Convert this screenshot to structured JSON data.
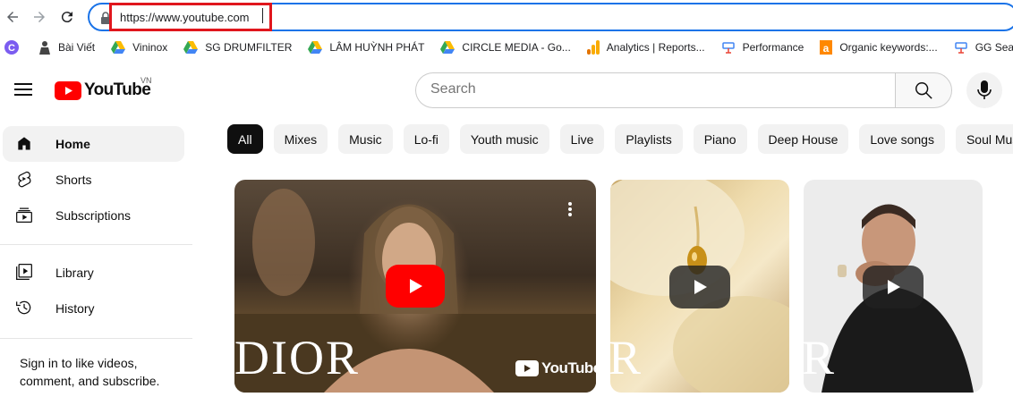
{
  "browser": {
    "url": "https://www.youtube.com"
  },
  "bookmarks": [
    {
      "label": "",
      "icon": "circle-c-icon"
    },
    {
      "label": "Bài Viết",
      "icon": "person-icon"
    },
    {
      "label": "Vininox",
      "icon": "drive-icon"
    },
    {
      "label": "SG DRUMFILTER",
      "icon": "drive-icon"
    },
    {
      "label": "LÂM HUỲNH PHÁT",
      "icon": "drive-icon"
    },
    {
      "label": "CIRCLE MEDIA - Go...",
      "icon": "drive-icon"
    },
    {
      "label": "Analytics | Reports...",
      "icon": "analytics-icon"
    },
    {
      "label": "Performance",
      "icon": "search-console-icon"
    },
    {
      "label": "Organic keywords:...",
      "icon": "ahrefs-icon"
    },
    {
      "label": "GG Search Console",
      "icon": "search-console-icon"
    }
  ],
  "masthead": {
    "logo_text": "YouTube",
    "country": "VN",
    "search_placeholder": "Search"
  },
  "sidebar": {
    "items": [
      {
        "label": "Home",
        "icon": "home-icon",
        "active": true
      },
      {
        "label": "Shorts",
        "icon": "shorts-icon"
      },
      {
        "label": "Subscriptions",
        "icon": "subscriptions-icon"
      },
      {
        "label": "Library",
        "icon": "library-icon"
      },
      {
        "label": "History",
        "icon": "history-icon"
      }
    ],
    "signin_text": "Sign in to like videos, comment, and subscribe."
  },
  "chips": [
    "All",
    "Mixes",
    "Music",
    "Lo-fi",
    "Youth music",
    "Live",
    "Playlists",
    "Piano",
    "Deep House",
    "Love songs",
    "Soul Music"
  ],
  "videos": [
    {
      "brand_text": "DIOR",
      "watermark": "YouTube"
    },
    {
      "brand_text": "R"
    },
    {
      "brand_text": "R"
    }
  ],
  "colors": {
    "youtube_red": "#ff0000",
    "play_red": "#ff0000",
    "focus_blue": "#1a73e8",
    "highlight_red": "#e0161d"
  }
}
